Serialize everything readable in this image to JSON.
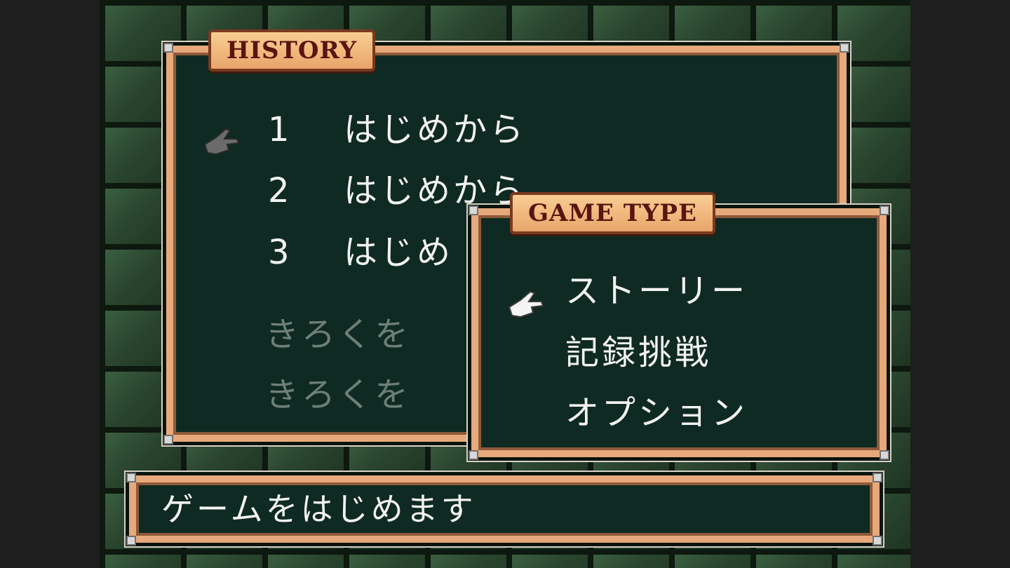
{
  "history": {
    "title": "HISTORY",
    "slots": [
      {
        "number": "1",
        "label": "はじめから"
      },
      {
        "number": "2",
        "label": "はじめから"
      },
      {
        "number": "3",
        "label": "はじめ"
      }
    ],
    "record_items": [
      "きろくを",
      "きろくを"
    ]
  },
  "game_type": {
    "title": "GAME TYPE",
    "options": [
      "ストーリー",
      "記録挑戦",
      "オプション"
    ],
    "selected_index": 0
  },
  "message": {
    "text": "ゲームをはじめます"
  },
  "colors": {
    "panel_bg": "#0f2a22",
    "frame": "#e7a97b",
    "label_text": "#5a1410",
    "active_text": "#f2f2f2",
    "dim_text": "#6d7f78"
  }
}
